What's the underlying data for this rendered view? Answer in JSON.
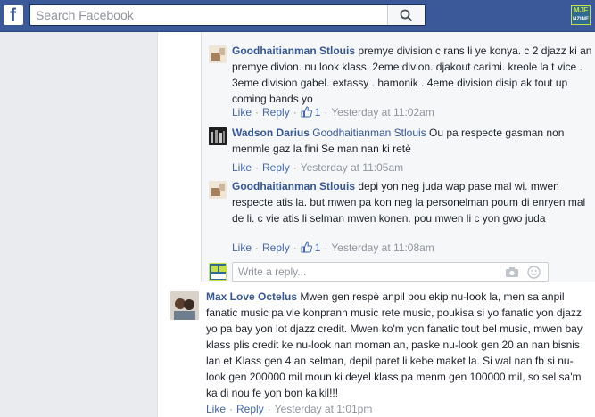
{
  "header": {
    "logo_letter": "f",
    "search_placeholder": "Search Facebook",
    "profile_logo_top": "MJF",
    "profile_logo_bottom": "NZINE"
  },
  "comments": [
    {
      "author": "Goodhaitianman Stlouis",
      "mention": "",
      "text": "premye division c rans li ye konya. c 2 djazz ki an premye divion. nu look klass. 2eme divion. djakout carimi. kreole la t vice . 3eme division gabel. extassy . hamonik . 4eme division disip ak tout up coming bands yo",
      "like_label": "Like",
      "reply_label": "Reply",
      "likes": "1",
      "time": "Yesterday at 11:02am"
    },
    {
      "author": "Wadson Darius",
      "mention": "Goodhaitianman Stlouis",
      "text": "Ou pa respecte gasman non menmle gaz la fini Se man nan ki retè",
      "like_label": "Like",
      "reply_label": "Reply",
      "likes": "",
      "time": "Yesterday at 11:05am"
    },
    {
      "author": "Goodhaitianman Stlouis",
      "mention": "",
      "text": "depi yon neg juda wap pase mal wi. mwen respecte atis la. but mwen pa kon neg la personelman poum di enryen mal de li. c vie atis li selman mwen konen. pou mwen li c yon gwo juda",
      "like_label": "Like",
      "reply_label": "Reply",
      "likes": "1",
      "time": "Yesterday at 11:08am"
    },
    {
      "author": "Max Love Octelus",
      "mention": "",
      "text": "Mwen gen respè anpil pou ekip nu-look la, men sa anpil fanatic music pa vle konprann music rete music, poukisa si yo fanatic yon djazz yo pa bay yon lot djazz credit. Mwen ko'm yon fanatic tout bel music, mwen bay klass plis credit ke nu-look nan moman an, paske nu-look gen 20 an nan bisnis lan et Klass gen 4 an selman, depil paret li kebe maket la. Si wal nan fb si nu-look gen 200000 mil moun ki deyel klass pa menm gen 100000 mil, so sel sa'm ka di nou fe yon bon kalkil!!!",
      "like_label": "Like",
      "reply_label": "Reply",
      "likes": "",
      "time": "Yesterday at 1:01pm"
    }
  ],
  "reply_box": {
    "placeholder": "Write a reply..."
  },
  "colors": {
    "topbar": "#3b5998",
    "link": "#365899",
    "action": "#4267b2",
    "meta": "#90949c"
  }
}
